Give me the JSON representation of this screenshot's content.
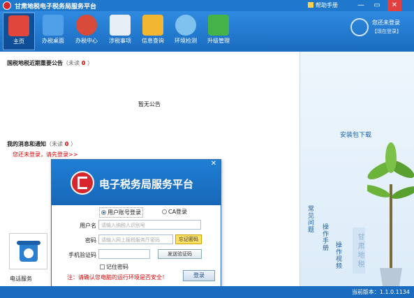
{
  "window": {
    "title": "甘肃地税电子税务局服务平台",
    "help": "帮助手册",
    "minimize": "—",
    "maximize": "▭",
    "close": "✕"
  },
  "toolbar": {
    "items": [
      {
        "label": "主页",
        "icon": "home-icon",
        "active": true,
        "color": "#e0463c"
      },
      {
        "label": "办税桌面",
        "icon": "desktop-icon",
        "active": false,
        "color": "#4fa0e8"
      },
      {
        "label": "办税中心",
        "icon": "tax-center-icon",
        "active": false,
        "color": "#d84a3a"
      },
      {
        "label": "涉税事项",
        "icon": "tax-matters-icon",
        "active": false,
        "color": "#e8eef6"
      },
      {
        "label": "信息查询",
        "icon": "info-search-icon",
        "active": false,
        "color": "#f2b632"
      },
      {
        "label": "环境检测",
        "icon": "env-check-icon",
        "active": false,
        "color": "#7fc2f0"
      },
      {
        "label": "升级管理",
        "icon": "upgrade-icon",
        "active": false,
        "color": "#46b24a"
      }
    ]
  },
  "user": {
    "status": "您还未登录",
    "login_link": "【现在登录】"
  },
  "notices": {
    "title": "国税地税近期重要公告",
    "unread_prefix": "（未读",
    "unread_count": "0",
    "unread_suffix": "）",
    "empty_text": "暂无公告"
  },
  "messages": {
    "title": "我的消息和通知",
    "unread_prefix": "（未读",
    "unread_count": "0",
    "unread_suffix": "）",
    "not_logged_in": "您还未登录，请先登录>>"
  },
  "phone_service": {
    "label": "电话服务",
    "icon": "telephone-icon"
  },
  "right_panel": {
    "download": "安装包下载",
    "faq": "常见问题",
    "manual": "操作手册",
    "video": "操作视频",
    "banner": "甘肃地税"
  },
  "login_dialog": {
    "title": "电子税务局服务平台",
    "close": "✕",
    "tab_account": "用户账号登录",
    "tab_ca": "CA登录",
    "username_label": "用户名",
    "username_placeholder": "请输入纳税人识别号",
    "password_label": "密码",
    "password_placeholder": "请输入网上报税服务厅密码",
    "forgot_button": "忘记密码",
    "phone_label": "手机验证码",
    "sms_button": "发送验证码",
    "remember": "记住密码",
    "warning": "注：请确认您电脑的运行环境是否安全！",
    "login_button": "登录"
  },
  "statusbar": {
    "version": "当前版本：1.1.0.1134"
  },
  "colors": {
    "titlebar": "#1f78cc",
    "toolbar": "#2f8ae0",
    "accent_red": "#d8262f",
    "link_blue": "#1d5fa8"
  }
}
